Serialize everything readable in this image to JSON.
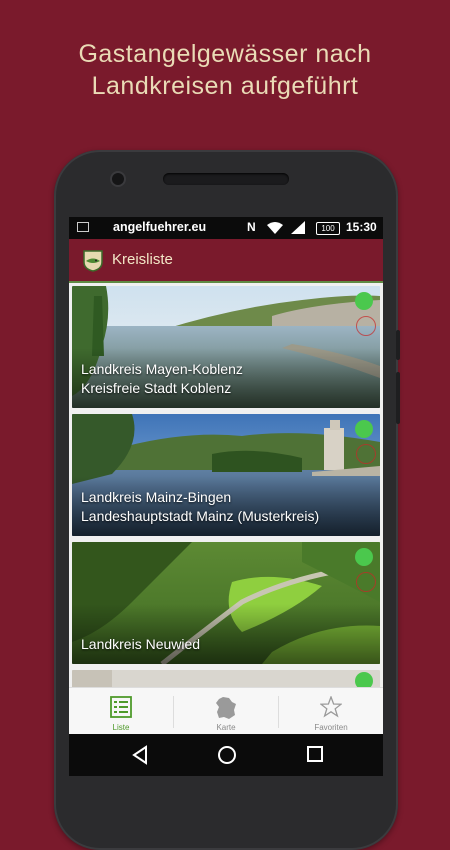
{
  "headline": [
    "Gastangelgewässer nach",
    "Landkreisen aufgeführt"
  ],
  "status_bar": {
    "site": "angelfuehrer.eu",
    "nfc": "N",
    "battery": "100",
    "time": "15:30"
  },
  "app_bar": {
    "title": "Kreisliste"
  },
  "colors": {
    "brand": "#7a1a2c",
    "accent_green": "#4bc84d",
    "nav_active": "#4f9a2b",
    "headline": "#eadbb6"
  },
  "districts": [
    {
      "line1": "Landkreis Mayen-Koblenz",
      "line2": "Kreisfreie Stadt Koblenz"
    },
    {
      "line1": "Landkreis Mainz-Bingen",
      "line2": "Landeshauptstadt Mainz (Musterkreis)"
    },
    {
      "line1": "Landkreis Neuwied",
      "line2": ""
    }
  ],
  "bottom_nav": {
    "items": [
      {
        "label": "Liste",
        "icon": "list-icon",
        "active": true
      },
      {
        "label": "Karte",
        "icon": "map-icon",
        "active": false
      },
      {
        "label": "Favoriten",
        "icon": "star-icon",
        "active": false
      }
    ]
  },
  "system_nav": [
    "back-icon",
    "home-icon",
    "recents-icon"
  ]
}
